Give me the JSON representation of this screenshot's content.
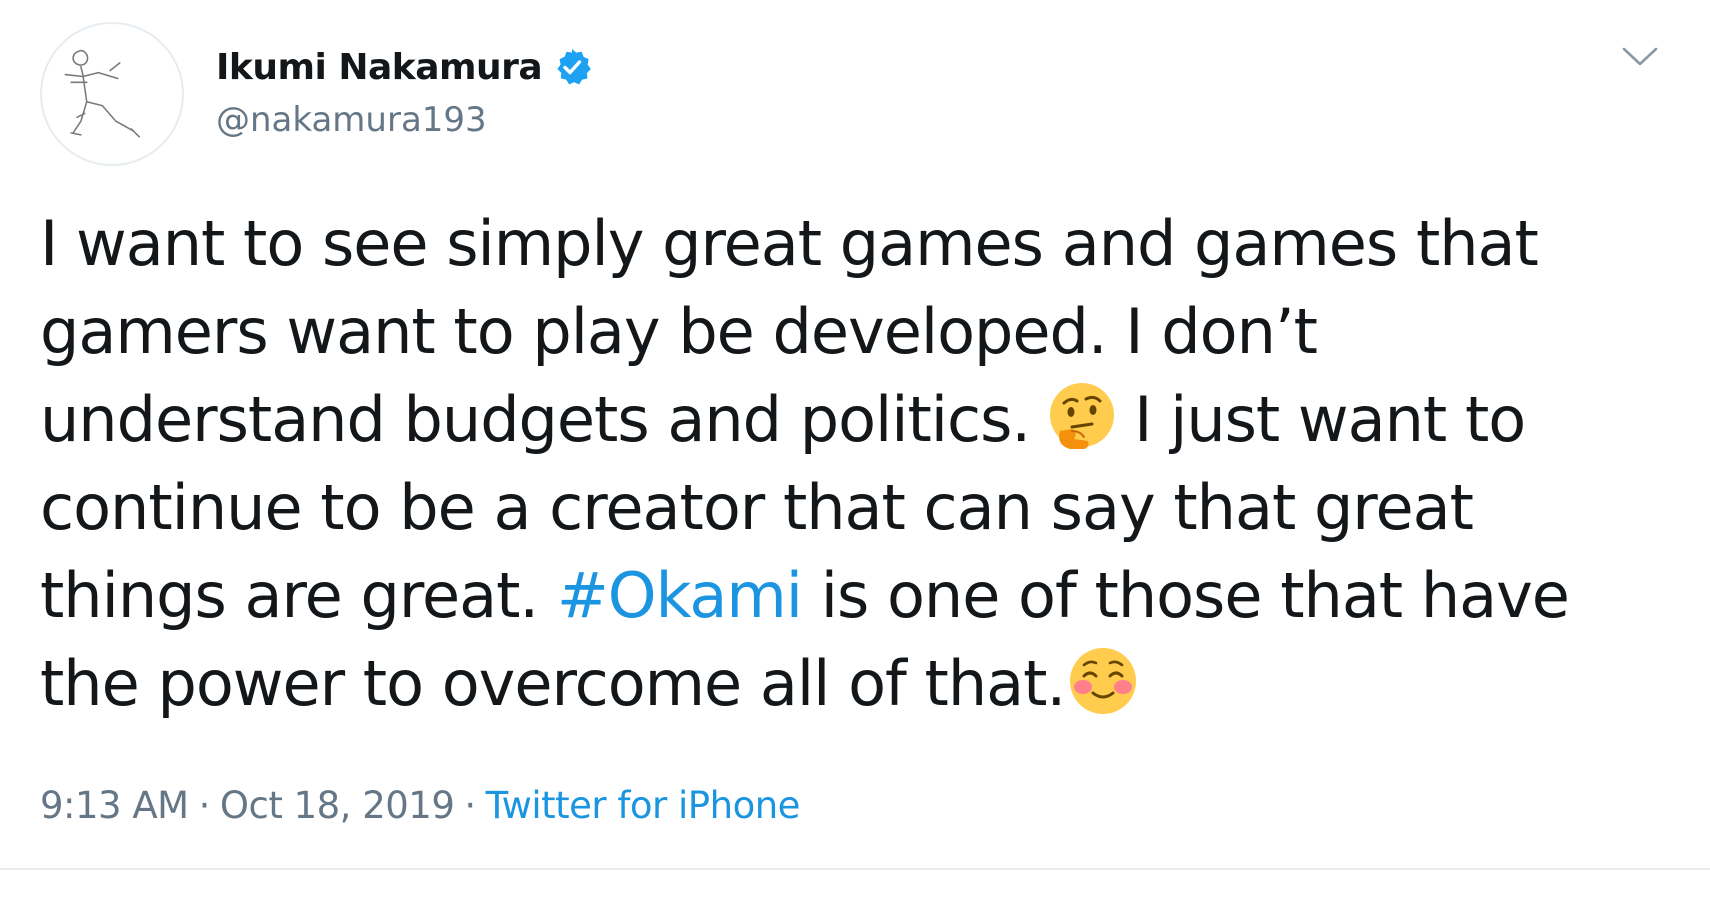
{
  "author": {
    "name": "Ikumi Nakamura",
    "handle": "@nakamura193",
    "verified": true,
    "verified_icon": "verified-badge-icon",
    "avatar_icon": "stick-figure-sketch"
  },
  "tweet": {
    "lines": [
      {
        "text": "I want to see simply great games and games that"
      },
      {
        "text": "gamers want to play be developed. I don’t"
      },
      {
        "before": "understand budgets and politics.",
        "emoji": "thinking-face-icon",
        "after": "I just want to"
      },
      {
        "text": "continue to be a creator that can say that great"
      },
      {
        "before": "things are great.",
        "hashtag": "#Okami",
        "after": "is one of those that have"
      },
      {
        "before": "the power to overcome all of that.",
        "emoji": "smiling-face-icon"
      }
    ]
  },
  "meta": {
    "time": "9:13 AM",
    "separator": "·",
    "date": "Oct 18, 2019",
    "source": "Twitter for iPhone"
  },
  "colors": {
    "text": "#14171a",
    "muted": "#657786",
    "link": "#1b95e0",
    "verified": "#1da1f2",
    "emoji_face": "#ffcc4d"
  }
}
